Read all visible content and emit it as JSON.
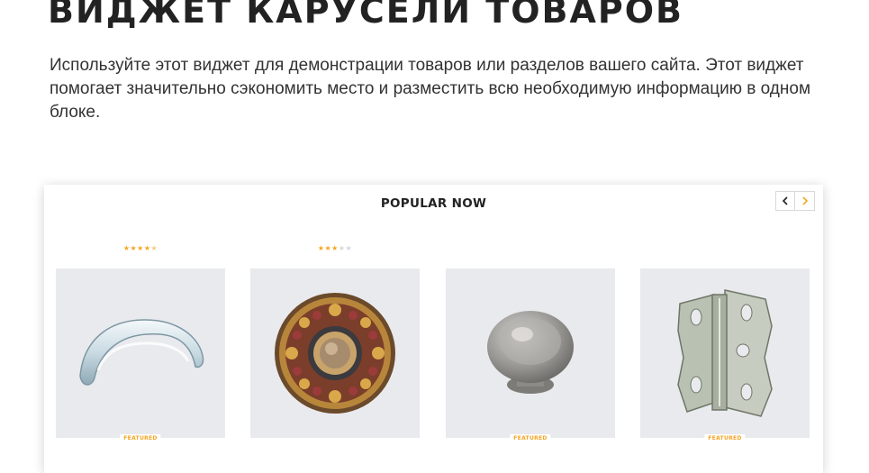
{
  "header": {
    "title": "ВИДЖЕТ КАРУСЕЛИ ТОВАРОВ",
    "description": "Используйте этот виджет для демонстрации товаров или разделов вашего сайта. Этот виджет помогает значительно сэкономить место и разместить всю необходимую информацию в одном блоке."
  },
  "carousel": {
    "title": "POPULAR NOW",
    "prev_icon": "chevron-left-icon",
    "next_icon": "chevron-right-icon",
    "accent_color": "#f5a623",
    "products": [
      {
        "image": "cup-pull-handle",
        "rating": 4.5,
        "rating_max": 5,
        "badge": "FEATURED"
      },
      {
        "image": "ornate-round-knob",
        "rating": 3,
        "rating_max": 5,
        "badge": ""
      },
      {
        "image": "round-cabinet-knob",
        "rating": null,
        "rating_max": 5,
        "badge": "FEATURED"
      },
      {
        "image": "cabinet-hinge",
        "rating": null,
        "rating_max": 5,
        "badge": "FEATURED"
      }
    ]
  }
}
